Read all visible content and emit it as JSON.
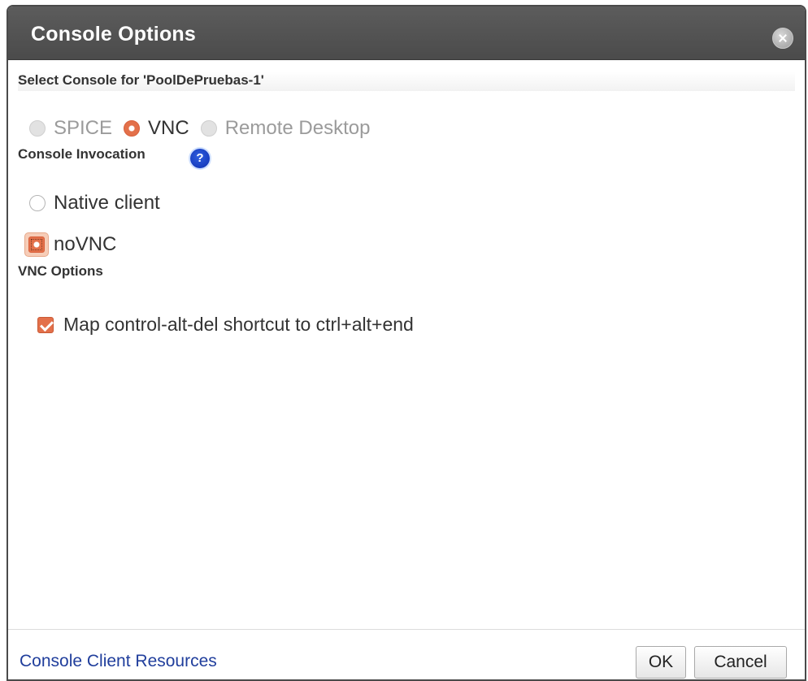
{
  "dialog": {
    "title": "Console Options",
    "close_icon": "close-icon"
  },
  "select_console": {
    "heading": "Select Console for 'PoolDePruebas-1'",
    "protocols": [
      {
        "label": "SPICE",
        "state": "disabled"
      },
      {
        "label": "VNC",
        "state": "selected"
      },
      {
        "label": "Remote Desktop",
        "state": "disabled"
      }
    ]
  },
  "invocation": {
    "heading": "Console Invocation",
    "help_icon": "help-icon",
    "help_glyph": "?",
    "options": [
      {
        "label": "Native client",
        "selected": false
      },
      {
        "label": "noVNC",
        "selected": true
      }
    ]
  },
  "vnc_options": {
    "heading": "VNC Options",
    "ctrl_alt_del": {
      "label": "Map control-alt-del shortcut to ctrl+alt+end",
      "checked": true
    }
  },
  "footer": {
    "resources_link": "Console Client Resources",
    "ok_label": "OK",
    "cancel_label": "Cancel"
  },
  "colors": {
    "titlebar": "#4b4b4b",
    "accent": "#e3704a",
    "link": "#203e9c",
    "help": "#0d2eb0"
  }
}
